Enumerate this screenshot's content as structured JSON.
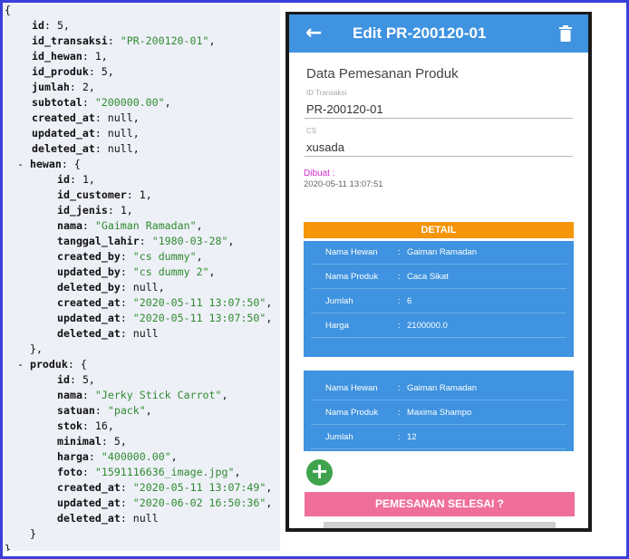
{
  "code_lines": [
    {
      "indent": "",
      "parts": [
        [
          "p",
          "{"
        ]
      ]
    },
    {
      "indent": "i1",
      "parts": [
        [
          "k",
          "id"
        ],
        [
          "p",
          ": "
        ],
        [
          "n",
          "5"
        ],
        [
          "p",
          ","
        ]
      ]
    },
    {
      "indent": "i1",
      "parts": [
        [
          "k",
          "id_transaksi"
        ],
        [
          "p",
          ": "
        ],
        [
          "s",
          "\"PR-200120-01\""
        ],
        [
          "p",
          ","
        ]
      ]
    },
    {
      "indent": "i1",
      "parts": [
        [
          "k",
          "id_hewan"
        ],
        [
          "p",
          ": "
        ],
        [
          "n",
          "1"
        ],
        [
          "p",
          ","
        ]
      ]
    },
    {
      "indent": "i1",
      "parts": [
        [
          "k",
          "id_produk"
        ],
        [
          "p",
          ": "
        ],
        [
          "n",
          "5"
        ],
        [
          "p",
          ","
        ]
      ]
    },
    {
      "indent": "i1",
      "parts": [
        [
          "k",
          "jumlah"
        ],
        [
          "p",
          ": "
        ],
        [
          "n",
          "2"
        ],
        [
          "p",
          ","
        ]
      ]
    },
    {
      "indent": "i1",
      "parts": [
        [
          "k",
          "subtotal"
        ],
        [
          "p",
          ": "
        ],
        [
          "s",
          "\"200000.00\""
        ],
        [
          "p",
          ","
        ]
      ]
    },
    {
      "indent": "i1",
      "parts": [
        [
          "k",
          "created_at"
        ],
        [
          "p",
          ": "
        ],
        [
          "nl",
          "null"
        ],
        [
          "p",
          ","
        ]
      ]
    },
    {
      "indent": "i1",
      "parts": [
        [
          "k",
          "updated_at"
        ],
        [
          "p",
          ": "
        ],
        [
          "nl",
          "null"
        ],
        [
          "p",
          ","
        ]
      ]
    },
    {
      "indent": "i1",
      "parts": [
        [
          "k",
          "deleted_at"
        ],
        [
          "p",
          ": "
        ],
        [
          "nl",
          "null"
        ],
        [
          "p",
          ","
        ]
      ]
    },
    {
      "indent": "i1m",
      "parts": [
        [
          "p",
          "- "
        ],
        [
          "k",
          "hewan"
        ],
        [
          "p",
          ": {"
        ]
      ]
    },
    {
      "indent": "i2",
      "parts": [
        [
          "k",
          "id"
        ],
        [
          "p",
          ": "
        ],
        [
          "n",
          "1"
        ],
        [
          "p",
          ","
        ]
      ]
    },
    {
      "indent": "i2",
      "parts": [
        [
          "k",
          "id_customer"
        ],
        [
          "p",
          ": "
        ],
        [
          "n",
          "1"
        ],
        [
          "p",
          ","
        ]
      ]
    },
    {
      "indent": "i2",
      "parts": [
        [
          "k",
          "id_jenis"
        ],
        [
          "p",
          ": "
        ],
        [
          "n",
          "1"
        ],
        [
          "p",
          ","
        ]
      ]
    },
    {
      "indent": "i2",
      "parts": [
        [
          "k",
          "nama"
        ],
        [
          "p",
          ": "
        ],
        [
          "s",
          "\"Gaiman Ramadan\""
        ],
        [
          "p",
          ","
        ]
      ]
    },
    {
      "indent": "i2",
      "parts": [
        [
          "k",
          "tanggal_lahir"
        ],
        [
          "p",
          ": "
        ],
        [
          "s",
          "\"1980-03-28\""
        ],
        [
          "p",
          ","
        ]
      ]
    },
    {
      "indent": "i2",
      "parts": [
        [
          "k",
          "created_by"
        ],
        [
          "p",
          ": "
        ],
        [
          "s",
          "\"cs dummy\""
        ],
        [
          "p",
          ","
        ]
      ]
    },
    {
      "indent": "i2",
      "parts": [
        [
          "k",
          "updated_by"
        ],
        [
          "p",
          ": "
        ],
        [
          "s",
          "\"cs dummy 2\""
        ],
        [
          "p",
          ","
        ]
      ]
    },
    {
      "indent": "i2",
      "parts": [
        [
          "k",
          "deleted_by"
        ],
        [
          "p",
          ": "
        ],
        [
          "nl",
          "null"
        ],
        [
          "p",
          ","
        ]
      ]
    },
    {
      "indent": "i2",
      "parts": [
        [
          "k",
          "created_at"
        ],
        [
          "p",
          ": "
        ],
        [
          "s",
          "\"2020-05-11 13:07:50\""
        ],
        [
          "p",
          ","
        ]
      ]
    },
    {
      "indent": "i2",
      "parts": [
        [
          "k",
          "updated_at"
        ],
        [
          "p",
          ": "
        ],
        [
          "s",
          "\"2020-05-11 13:07:50\""
        ],
        [
          "p",
          ","
        ]
      ]
    },
    {
      "indent": "i2",
      "parts": [
        [
          "k",
          "deleted_at"
        ],
        [
          "p",
          ": "
        ],
        [
          "nl",
          "null"
        ]
      ]
    },
    {
      "indent": "i1m",
      "parts": [
        [
          "p",
          "  },"
        ]
      ]
    },
    {
      "indent": "i1m",
      "parts": [
        [
          "p",
          "- "
        ],
        [
          "k",
          "produk"
        ],
        [
          "p",
          ": {"
        ]
      ]
    },
    {
      "indent": "i2",
      "parts": [
        [
          "k",
          "id"
        ],
        [
          "p",
          ": "
        ],
        [
          "n",
          "5"
        ],
        [
          "p",
          ","
        ]
      ]
    },
    {
      "indent": "i2",
      "parts": [
        [
          "k",
          "nama"
        ],
        [
          "p",
          ": "
        ],
        [
          "s",
          "\"Jerky Stick Carrot\""
        ],
        [
          "p",
          ","
        ]
      ]
    },
    {
      "indent": "i2",
      "parts": [
        [
          "k",
          "satuan"
        ],
        [
          "p",
          ": "
        ],
        [
          "s",
          "\"pack\""
        ],
        [
          "p",
          ","
        ]
      ]
    },
    {
      "indent": "i2",
      "parts": [
        [
          "k",
          "stok"
        ],
        [
          "p",
          ": "
        ],
        [
          "n",
          "16"
        ],
        [
          "p",
          ","
        ]
      ]
    },
    {
      "indent": "i2",
      "parts": [
        [
          "k",
          "minimal"
        ],
        [
          "p",
          ": "
        ],
        [
          "n",
          "5"
        ],
        [
          "p",
          ","
        ]
      ]
    },
    {
      "indent": "i2",
      "parts": [
        [
          "k",
          "harga"
        ],
        [
          "p",
          ": "
        ],
        [
          "s",
          "\"400000.00\""
        ],
        [
          "p",
          ","
        ]
      ]
    },
    {
      "indent": "i2",
      "parts": [
        [
          "k",
          "foto"
        ],
        [
          "p",
          ": "
        ],
        [
          "s",
          "\"1591116636_image.jpg\""
        ],
        [
          "p",
          ","
        ]
      ]
    },
    {
      "indent": "i2",
      "parts": [
        [
          "k",
          "created_at"
        ],
        [
          "p",
          ": "
        ],
        [
          "s",
          "\"2020-05-11 13:07:49\""
        ],
        [
          "p",
          ","
        ]
      ]
    },
    {
      "indent": "i2",
      "parts": [
        [
          "k",
          "updated_at"
        ],
        [
          "p",
          ": "
        ],
        [
          "s",
          "\"2020-06-02 16:50:36\""
        ],
        [
          "p",
          ","
        ]
      ]
    },
    {
      "indent": "i2",
      "parts": [
        [
          "k",
          "deleted_at"
        ],
        [
          "p",
          ": "
        ],
        [
          "nl",
          "null"
        ]
      ]
    },
    {
      "indent": "i1m",
      "parts": [
        [
          "p",
          "  }"
        ]
      ]
    },
    {
      "indent": "",
      "parts": [
        [
          "p",
          "},"
        ]
      ]
    }
  ],
  "app": {
    "title": "Edit PR-200120-01",
    "section_title": "Data Pemesanan Produk",
    "id_transaksi_label": "ID Transaksi",
    "id_transaksi_value": "PR-200120-01",
    "cs_label": "CS",
    "cs_value": "xusada",
    "dibuat_label": "Dibuat :",
    "dibuat_value": "2020-05-11 13:07:51",
    "detail_label": "DETAIL",
    "card1": {
      "rows": [
        {
          "label": "Nama Hewan",
          "sep": ":",
          "value": "Gaiman Ramadan"
        },
        {
          "label": "Nama Produk",
          "sep": ":",
          "value": "Caca Sikat"
        },
        {
          "label": "Jumlah",
          "sep": ":",
          "value": "6"
        },
        {
          "label": "Harga",
          "sep": ":",
          "value": "2100000.0"
        }
      ]
    },
    "card2": {
      "rows": [
        {
          "label": "Nama Hewan",
          "sep": ":",
          "value": "Gaiman Ramadan"
        },
        {
          "label": "Nama Produk",
          "sep": ":",
          "value": "Maxima Shampo"
        },
        {
          "label": "Jumlah",
          "sep": ":",
          "value": "12"
        }
      ]
    },
    "add_icon": "plus-icon",
    "finish_button": "PEMESANAN SELESAI ?",
    "back_icon": "arrow-left-icon",
    "delete_icon": "trash-icon"
  },
  "colors": {
    "appbar": "#3f93e0",
    "detail_bar": "#f5950a",
    "card": "#3f93e0",
    "fab": "#3fa34d",
    "finish_button": "#ef6f99",
    "dibuat_label": "#d52bd1",
    "frame_border": "#3a3fd8"
  }
}
